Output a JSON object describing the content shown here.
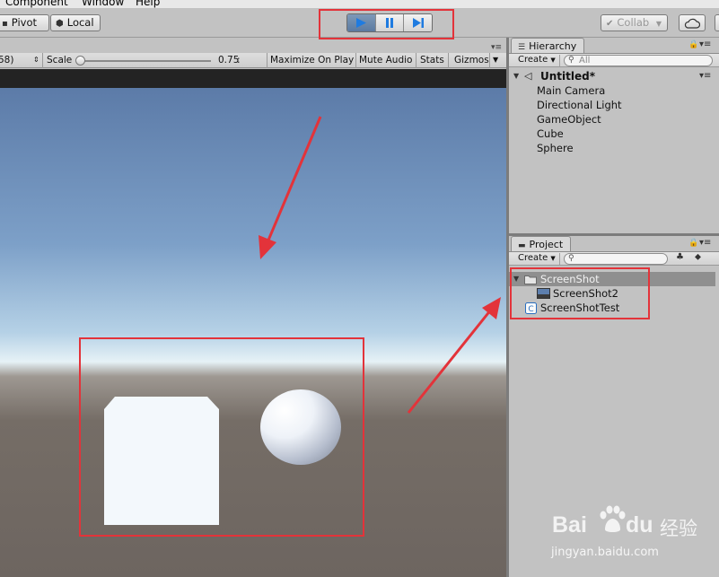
{
  "menu": {
    "items": [
      "Component",
      "Window",
      "Help"
    ]
  },
  "toolbar": {
    "pivot_label": "Pivot",
    "local_label": "Local",
    "collab_label": "Collab",
    "play_icon": "play-icon",
    "pause_icon": "pause-icon",
    "step_icon": "step-icon",
    "play_state": "active"
  },
  "game": {
    "resolution_fragment": "58)",
    "scale_label": "Scale",
    "scale_value": "0.75",
    "maximize_label": "Maximize On Play",
    "mute_label": "Mute Audio",
    "stats_label": "Stats",
    "gizmos_label": "Gizmos"
  },
  "hierarchy": {
    "tab_label": "Hierarchy",
    "create_label": "Create",
    "search_placeholder": "All",
    "scene_name": "Untitled*",
    "items": [
      "Main Camera",
      "Directional Light",
      "GameObject",
      "Cube",
      "Sphere"
    ]
  },
  "project": {
    "tab_label": "Project",
    "create_label": "Create",
    "folder_name": "ScreenShot",
    "items": [
      "ScreenShot2",
      "ScreenShotTest"
    ]
  },
  "watermark": {
    "logo_text": "Bai",
    "logo_text2": "du",
    "cn_text": "经验",
    "url": "jingyan.baidu.com"
  },
  "colors": {
    "highlight": "#e3333a",
    "play_active": "#5b7aa0",
    "selection": "#8f8f8f",
    "sky_top": "#5c7ba8",
    "ground": "#6d6560"
  }
}
